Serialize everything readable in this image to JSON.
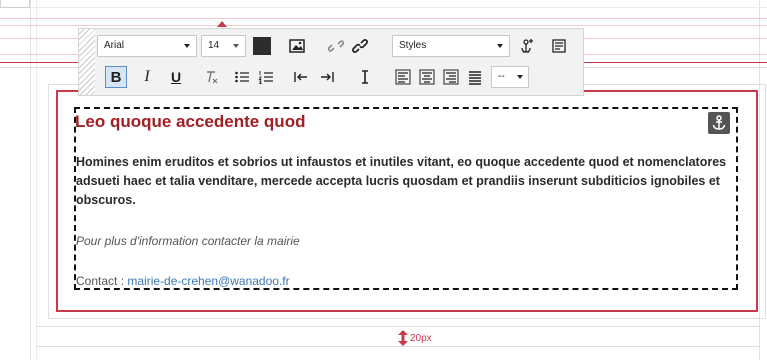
{
  "toolbar": {
    "font_family": "Arial",
    "font_size": "14",
    "styles_label": "Styles",
    "format_label": "--"
  },
  "content": {
    "heading": "Leo quoque accedente quod",
    "paragraph": "Homines enim eruditos et sobrios ut infaustos et inutiles vitant, eo quoque accedente quod et nomenclatores adsueti haec et talia venditare, mercede accepta lucris quosdam et prandiis inserunt subditicios ignobiles et obscuros.",
    "info": "Pour plus d'information contacter la mairie",
    "contact_label": "Contact : ",
    "contact_email": "mairie-de-crehen@wanadoo.fr"
  },
  "spacing_label": "20px",
  "colors": {
    "guide_red": "#c83a4a",
    "heading": "#a21e22",
    "link": "#3a78b8",
    "active_btn": "#d6e6f6"
  }
}
